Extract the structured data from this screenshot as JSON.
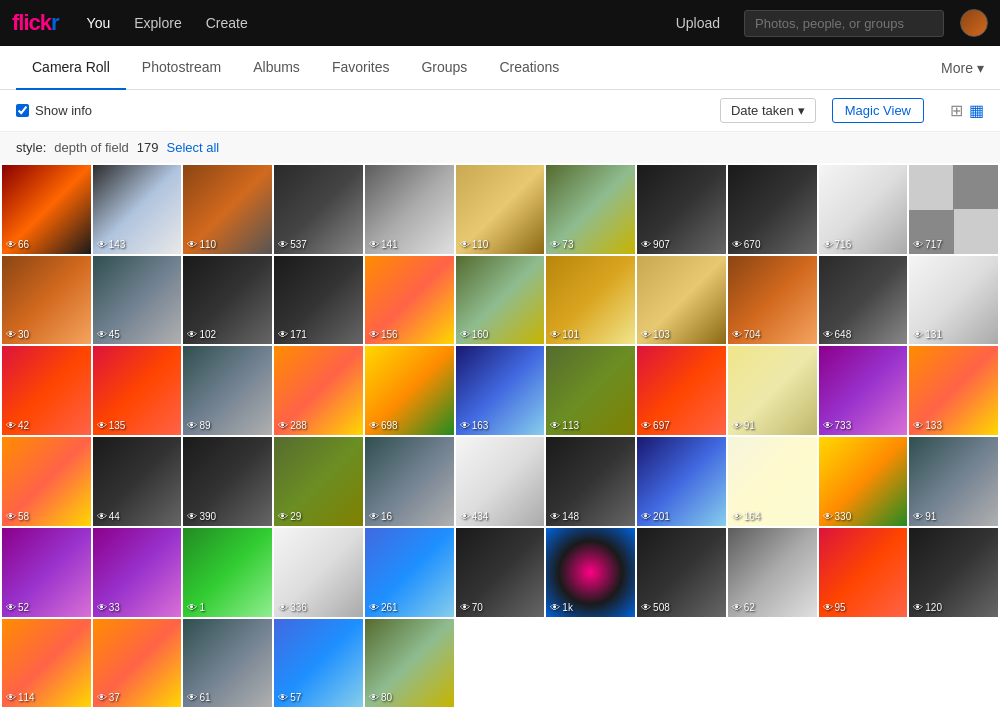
{
  "header": {
    "logo_pink": "flick",
    "logo_blue": "r",
    "nav": [
      {
        "label": "You",
        "active": true
      },
      {
        "label": "Explore"
      },
      {
        "label": "Create"
      }
    ],
    "upload_label": "Upload",
    "search_placeholder": "Photos, people, or groups",
    "more_label": "More"
  },
  "subnav": {
    "tabs": [
      {
        "label": "Camera Roll",
        "active": true
      },
      {
        "label": "Photostream"
      },
      {
        "label": "Albums"
      },
      {
        "label": "Favorites"
      },
      {
        "label": "Groups"
      },
      {
        "label": "Creations"
      }
    ],
    "more_label": "More"
  },
  "toolbar": {
    "show_info_label": "Show info",
    "date_sort_label": "Date taken",
    "magic_view_label": "Magic View"
  },
  "style_bar": {
    "prefix": "style:",
    "label": "depth of field",
    "count": "179",
    "select_all_label": "Select all"
  },
  "photos": [
    {
      "count": "66",
      "class": "c1"
    },
    {
      "count": "143",
      "class": "c2"
    },
    {
      "count": "110",
      "class": "c3"
    },
    {
      "count": "537",
      "class": "c4"
    },
    {
      "count": "141",
      "class": "c5"
    },
    {
      "count": "110",
      "class": "c6"
    },
    {
      "count": "73",
      "class": "c7"
    },
    {
      "count": "907",
      "class": "c11"
    },
    {
      "count": "670",
      "class": "c11"
    },
    {
      "count": "716",
      "class": "c10"
    },
    {
      "count": "717",
      "class": "c29"
    },
    {
      "count": "30",
      "class": "c17"
    },
    {
      "count": "45",
      "class": "c9"
    },
    {
      "count": "102",
      "class": "c11"
    },
    {
      "count": "171",
      "class": "c11"
    },
    {
      "count": "156",
      "class": "c18"
    },
    {
      "count": "160",
      "class": "c7"
    },
    {
      "count": "101",
      "class": "c21"
    },
    {
      "count": "103",
      "class": "c6"
    },
    {
      "count": "704",
      "class": "c17"
    },
    {
      "count": "648",
      "class": "c4"
    },
    {
      "count": "131",
      "class": "c10"
    },
    {
      "count": "42",
      "class": "c15"
    },
    {
      "count": "135",
      "class": "c15"
    },
    {
      "count": "89",
      "class": "c9"
    },
    {
      "count": "288",
      "class": "c18"
    },
    {
      "count": "698",
      "class": "c13"
    },
    {
      "count": "163",
      "class": "c26"
    },
    {
      "count": "113",
      "class": "c22"
    },
    {
      "count": "697",
      "class": "c15"
    },
    {
      "count": "91",
      "class": "c19"
    },
    {
      "count": "733",
      "class": "c24"
    },
    {
      "count": "133",
      "class": "c18"
    },
    {
      "count": "58",
      "class": "c18"
    },
    {
      "count": "44",
      "class": "c11"
    },
    {
      "count": "390",
      "class": "c11"
    },
    {
      "count": "29",
      "class": "c22"
    },
    {
      "count": "16",
      "class": "c9"
    },
    {
      "count": "434",
      "class": "c10"
    },
    {
      "count": "148",
      "class": "c11"
    },
    {
      "count": "201",
      "class": "c26"
    },
    {
      "count": "164",
      "class": "c27"
    },
    {
      "count": "330",
      "class": "c13"
    },
    {
      "count": "91",
      "class": "c9"
    },
    {
      "count": "52",
      "class": "c24"
    },
    {
      "count": "33",
      "class": "c24"
    },
    {
      "count": "1",
      "class": "c16"
    },
    {
      "count": "336",
      "class": "c10"
    },
    {
      "count": "261",
      "class": "c14"
    },
    {
      "count": "70",
      "class": "c11"
    },
    {
      "count": "1k",
      "class": "c28"
    },
    {
      "count": "508",
      "class": "c11"
    },
    {
      "count": "62",
      "class": "c5"
    },
    {
      "count": "95",
      "class": "c15"
    },
    {
      "count": "120",
      "class": "c11"
    },
    {
      "count": "114",
      "class": "c18"
    },
    {
      "count": "37",
      "class": "c18"
    },
    {
      "count": "61",
      "class": "c9"
    },
    {
      "count": "57",
      "class": "c14"
    },
    {
      "count": "80",
      "class": "c7"
    }
  ]
}
